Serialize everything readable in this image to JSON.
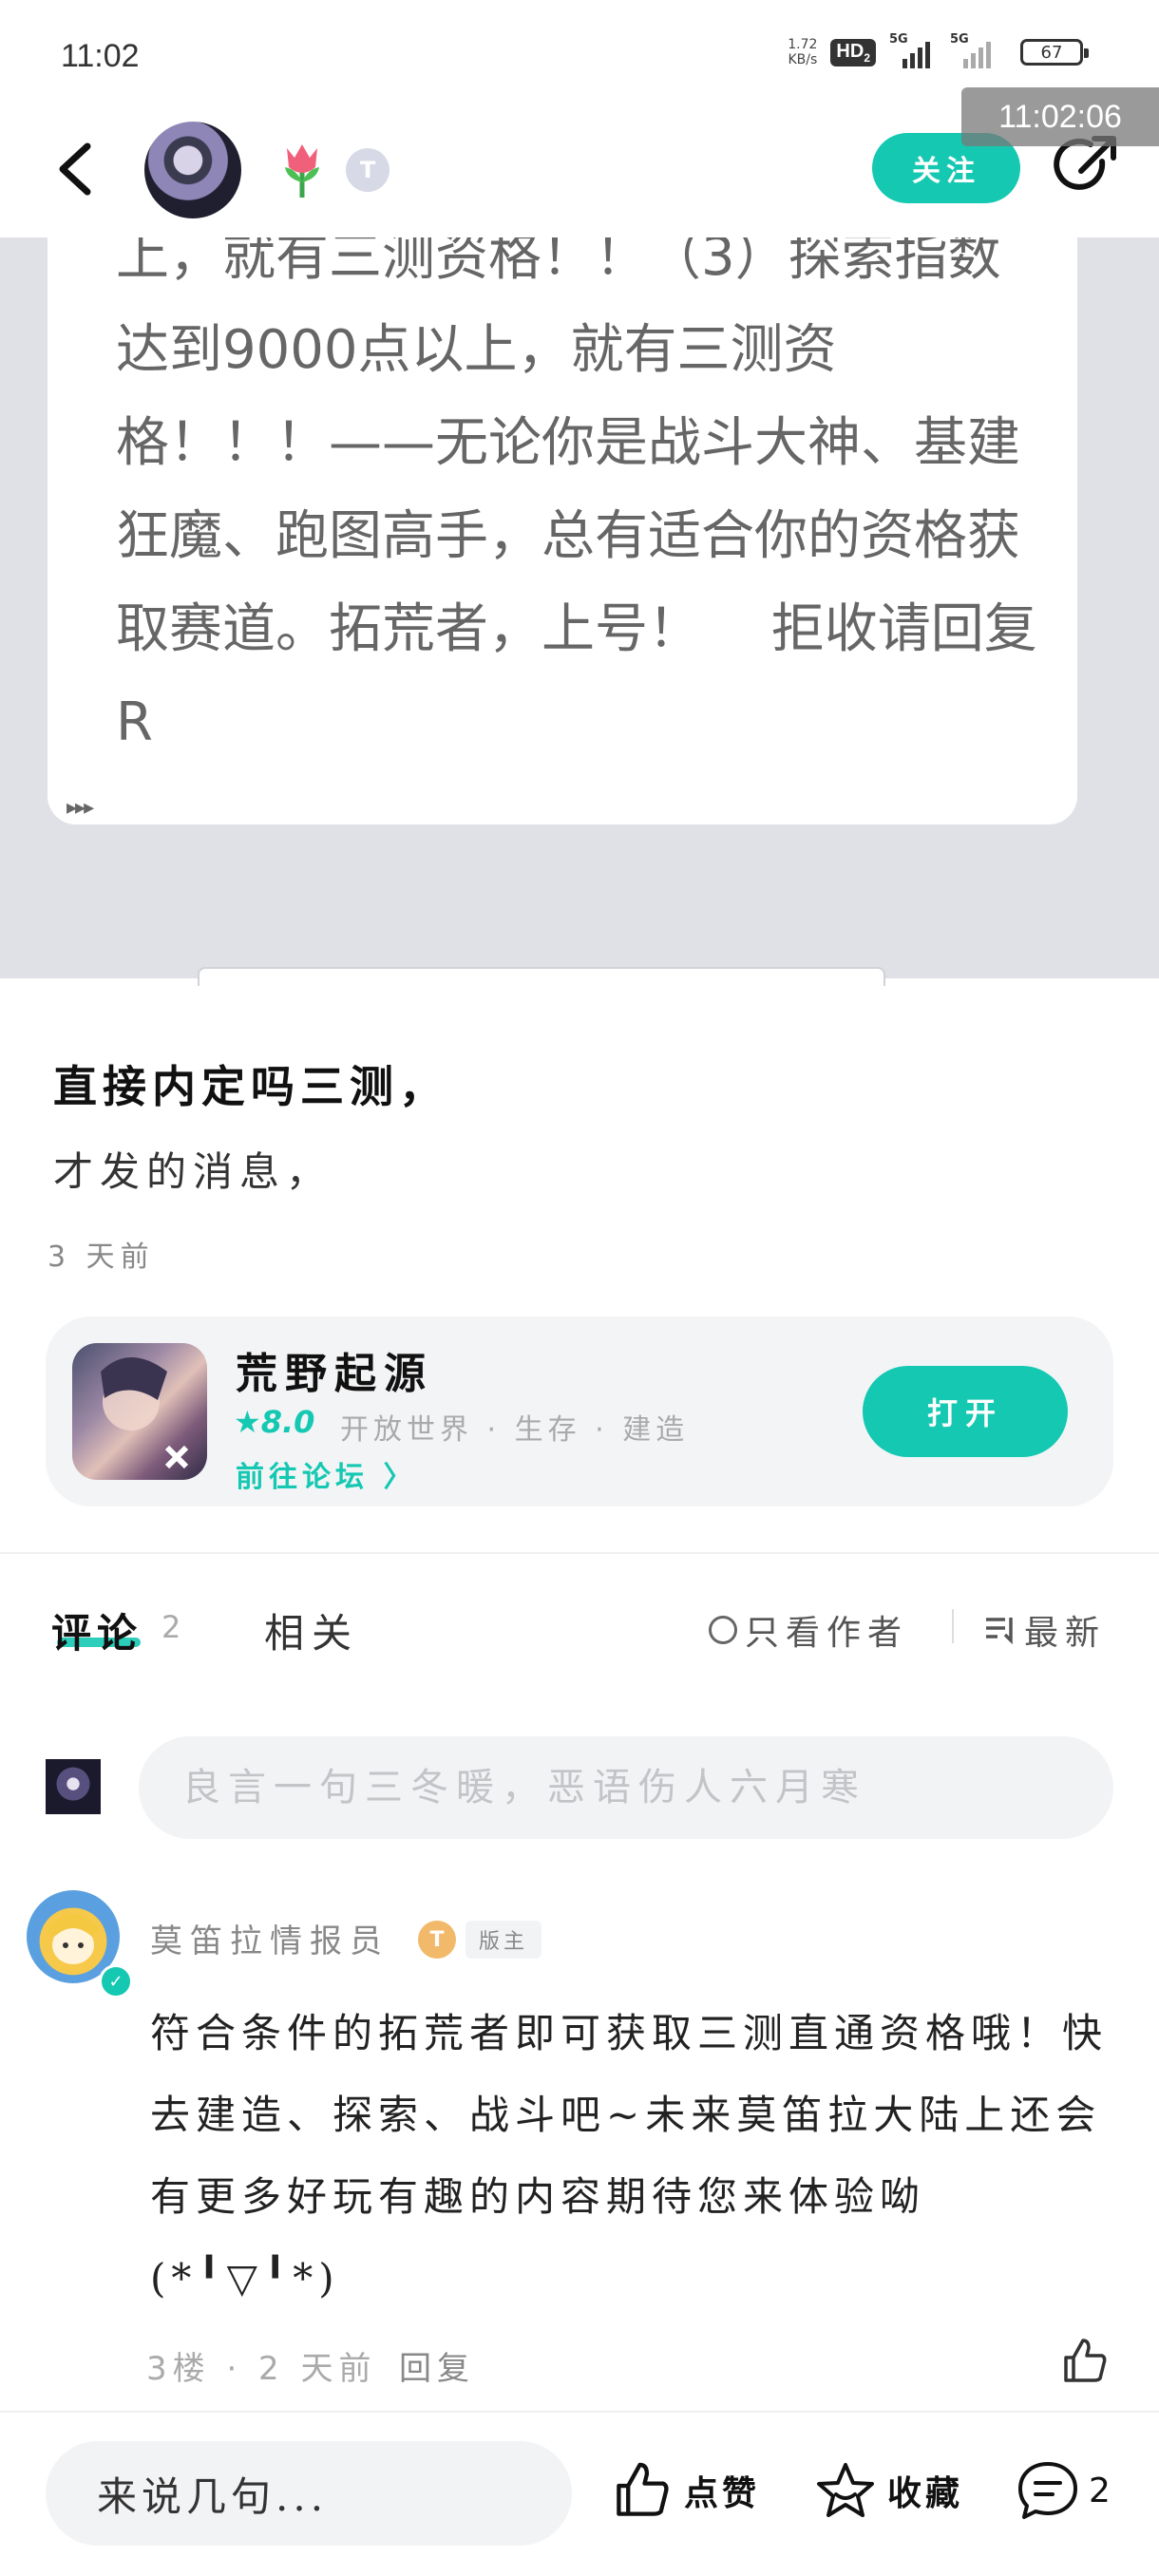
{
  "status_bar": {
    "time": "11:02",
    "net_speed_value": "1.72",
    "net_speed_unit": "KB/s",
    "hd_label": "HD",
    "hd_sub": "2",
    "sig1_label": "5G",
    "sig2_label": "5G",
    "battery": "67"
  },
  "clock_overlay": "11:02:06",
  "header": {
    "follow_label": "关注",
    "tier_label": "T"
  },
  "image_post": {
    "text": "上，就有三测资格！！（3）探索指数达到9000点以上，就有三测资格！！！——无论你是战斗大神、基建狂魔、跑图高手，总有适合你的资格获取赛道。拓荒者，上号！　 拒收请回复R",
    "more": "▸▸▸"
  },
  "post": {
    "title": "直接内定吗三测，",
    "body": "才发的消息，",
    "time": "3 天前"
  },
  "game": {
    "name": "荒野起源",
    "rating": "★8.0",
    "tags": "开放世界 · 生存 · 建造",
    "forum_link": "前往论坛 〉",
    "open_label": "打开"
  },
  "tabs": {
    "comments_label": "评论",
    "comments_count": "2",
    "related_label": "相关",
    "author_only": "只看作者",
    "sort": "最新"
  },
  "comment_input": {
    "placeholder": "良言一句三冬暖，恶语伤人六月寒"
  },
  "comments": [
    {
      "author": "莫笛拉情报员",
      "tier": "T",
      "role": "版主",
      "body": "符合条件的拓荒者即可获取三测直通资格哦！快去建造、探索、战斗吧~未来莫笛拉大陆上还会有更多好玩有趣的内容期待您来体验呦(*╹▽╹*)",
      "floor_time": "3楼 · 2 天前",
      "reply_label": "回复"
    }
  ],
  "bottom_bar": {
    "input_label": "来说几句...",
    "like_label": "点赞",
    "fav_label": "收藏",
    "comment_count": "2"
  },
  "colors": {
    "accent": "#15c8b2",
    "gray_bg": "#dfe1e7"
  }
}
